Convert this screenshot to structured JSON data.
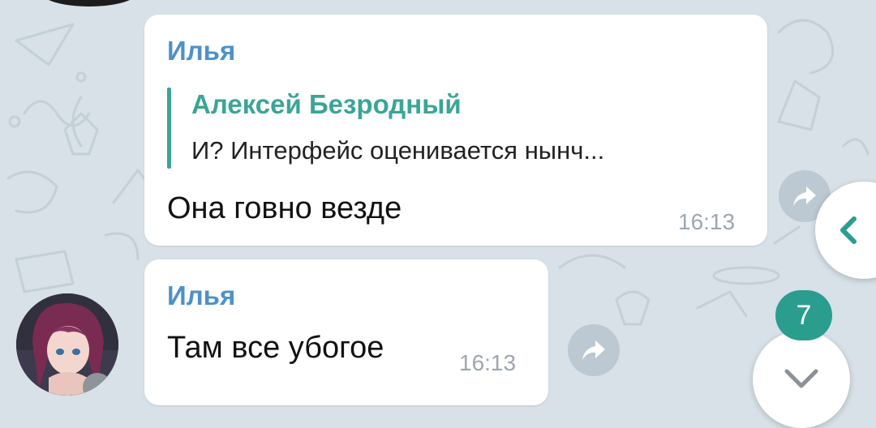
{
  "messages": [
    {
      "sender": "Илья",
      "reply": {
        "author": "Алексей Безродный",
        "text": "И? Интерфейс оценивается нынч..."
      },
      "text": "Она говно везде",
      "time": "16:13"
    },
    {
      "sender": "Илья",
      "text": "Там все убогое",
      "time": "16:13"
    }
  ],
  "scroll_nav": {
    "unread_count": "7"
  },
  "icons": {
    "share": "share-icon",
    "back": "chevron-left-icon",
    "scroll_down": "chevron-down-icon"
  },
  "colors": {
    "sender_name": "#4d92c7",
    "reply_accent": "#3aa597",
    "badge": "#2a9d8f",
    "background": "#d7e1e7"
  }
}
